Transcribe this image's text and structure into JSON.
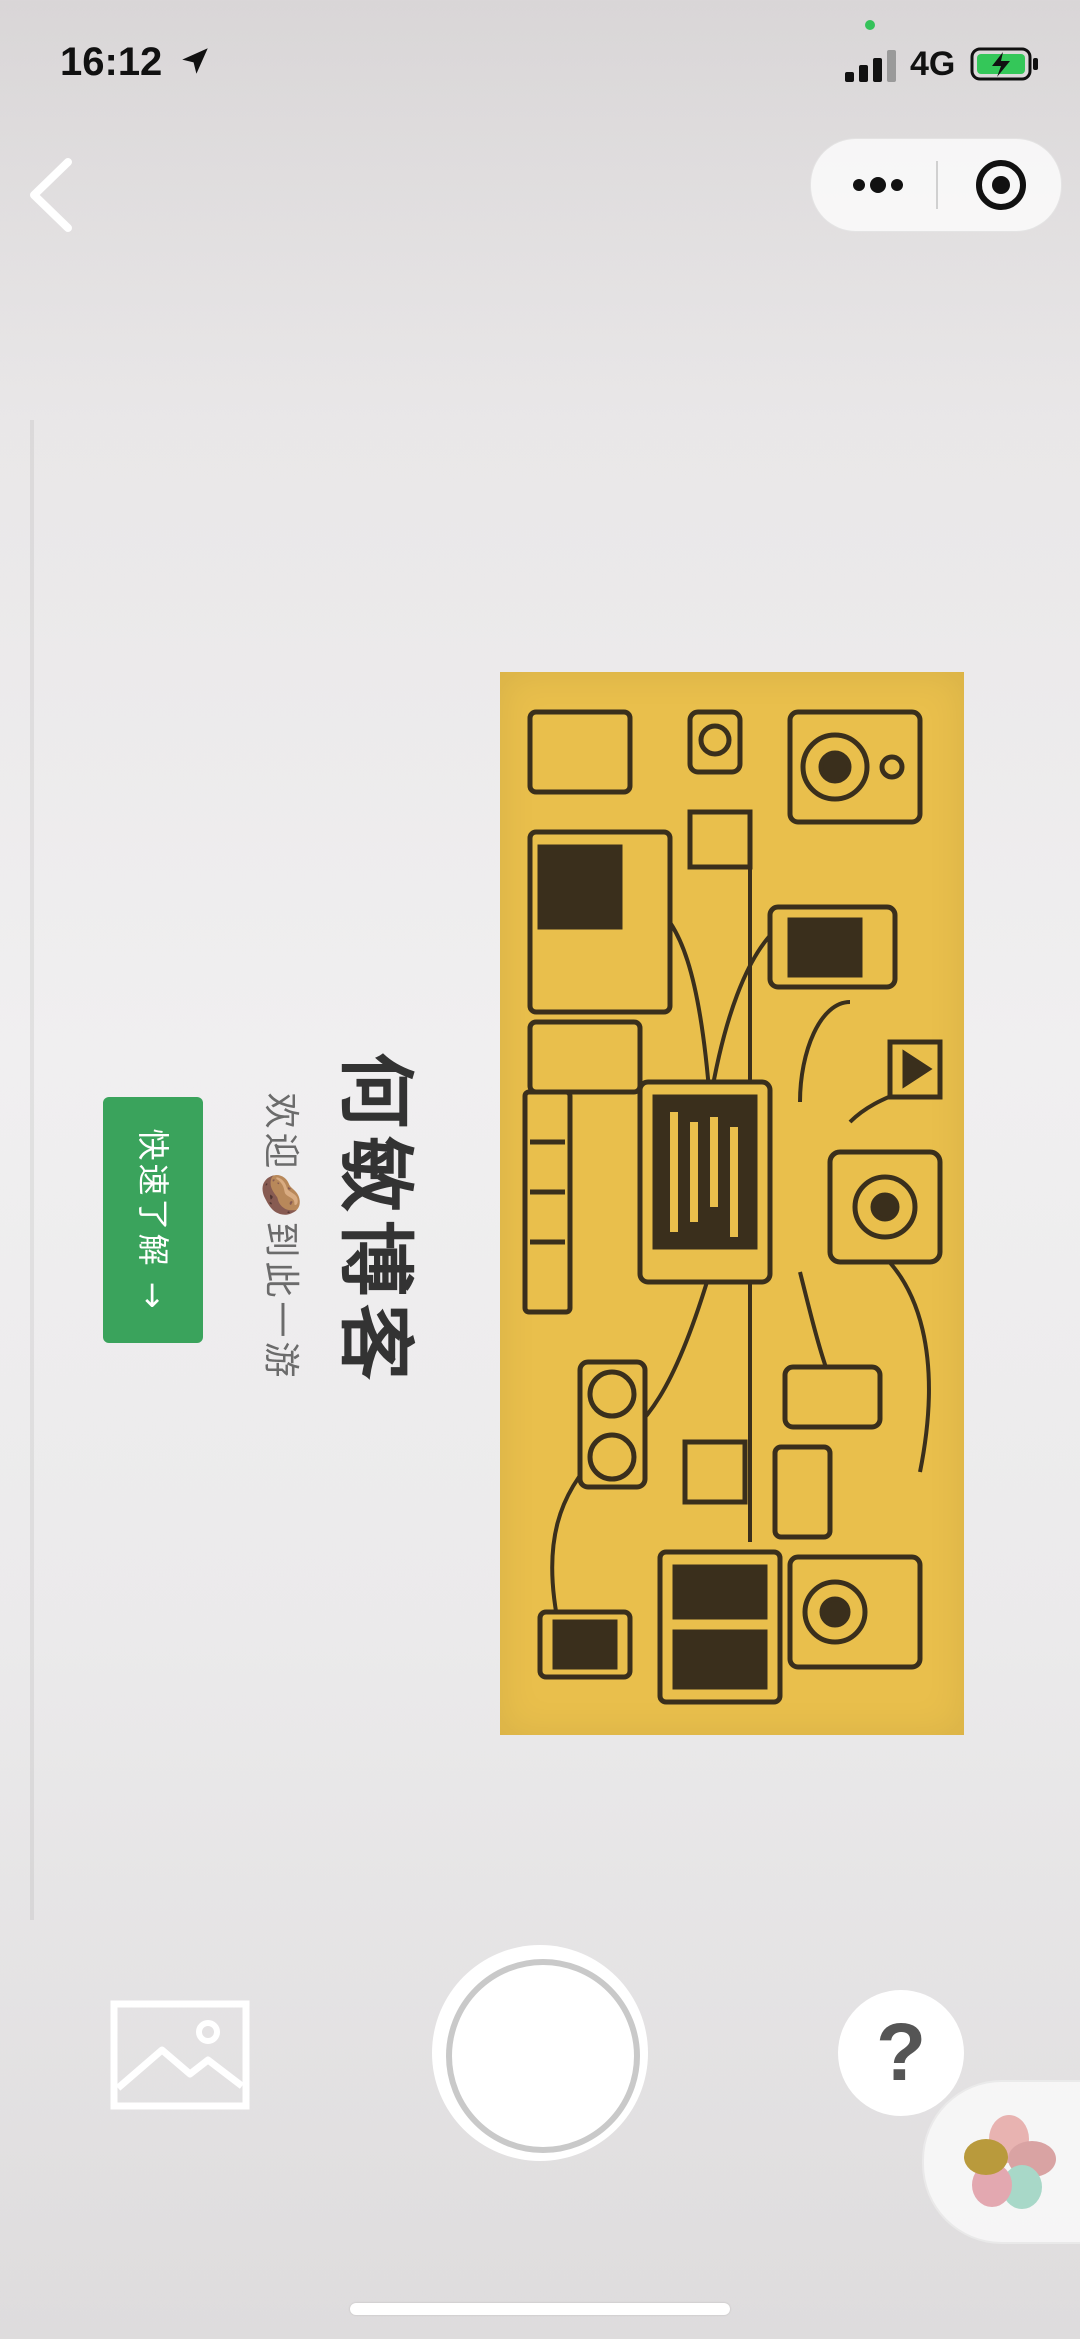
{
  "status_bar": {
    "time": "16:12",
    "network": "4G",
    "icons": [
      "location-arrow-icon",
      "signal-icon",
      "battery-charging-icon"
    ]
  },
  "nav": {
    "back_icon": "chevron-left-icon",
    "capsule": {
      "more_icon": "more-dots-icon",
      "close_icon": "target-close-icon"
    }
  },
  "document": {
    "title": "何敏博客",
    "subtitle": "欢迎🥔到此一游",
    "button_label": "快速了解 →",
    "banner_colors": {
      "background": "#e9bf4c",
      "line": "#3a2f1c"
    }
  },
  "camera_controls": {
    "album_icon": "image-icon",
    "shutter_icon": "shutter-button",
    "help_label": "?",
    "float_icon": "app-flower-icon"
  },
  "colors": {
    "accent_green": "#3aa35c",
    "screen_bg": "#ebeaeb"
  }
}
